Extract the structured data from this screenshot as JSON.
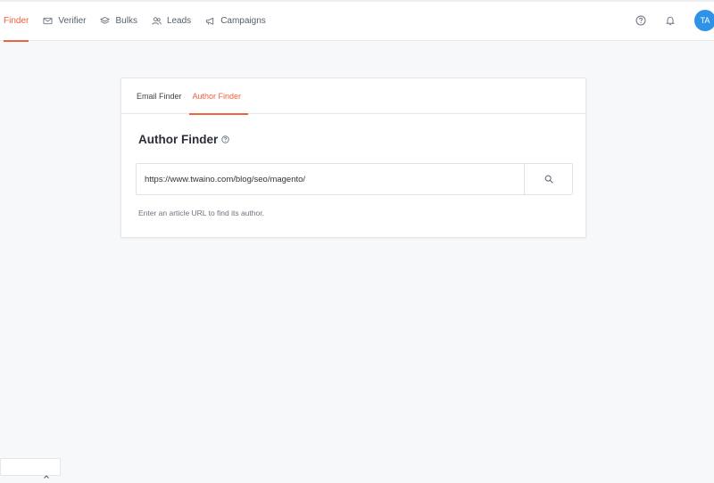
{
  "nav": {
    "items": [
      {
        "label": "Finder",
        "icon": "search-icon",
        "active": true
      },
      {
        "label": "Verifier",
        "icon": "mail-check-icon"
      },
      {
        "label": "Bulks",
        "icon": "layers-icon"
      },
      {
        "label": "Leads",
        "icon": "users-icon"
      },
      {
        "label": "Campaigns",
        "icon": "megaphone-icon"
      }
    ],
    "accent": "#f0613d"
  },
  "header": {
    "help_icon": "help-circle-icon",
    "notifications_icon": "bell-icon",
    "avatar_initials": "TA",
    "avatar_color": "#2e93e8"
  },
  "card": {
    "tabs": [
      {
        "label": "Email Finder"
      },
      {
        "label": "Author Finder",
        "active": true
      }
    ],
    "title": "Author Finder",
    "search": {
      "value": "https://www.twaino.com/blog/seo/magento/",
      "button_icon": "search-icon"
    },
    "hint": "Enter an article URL to find its author."
  }
}
